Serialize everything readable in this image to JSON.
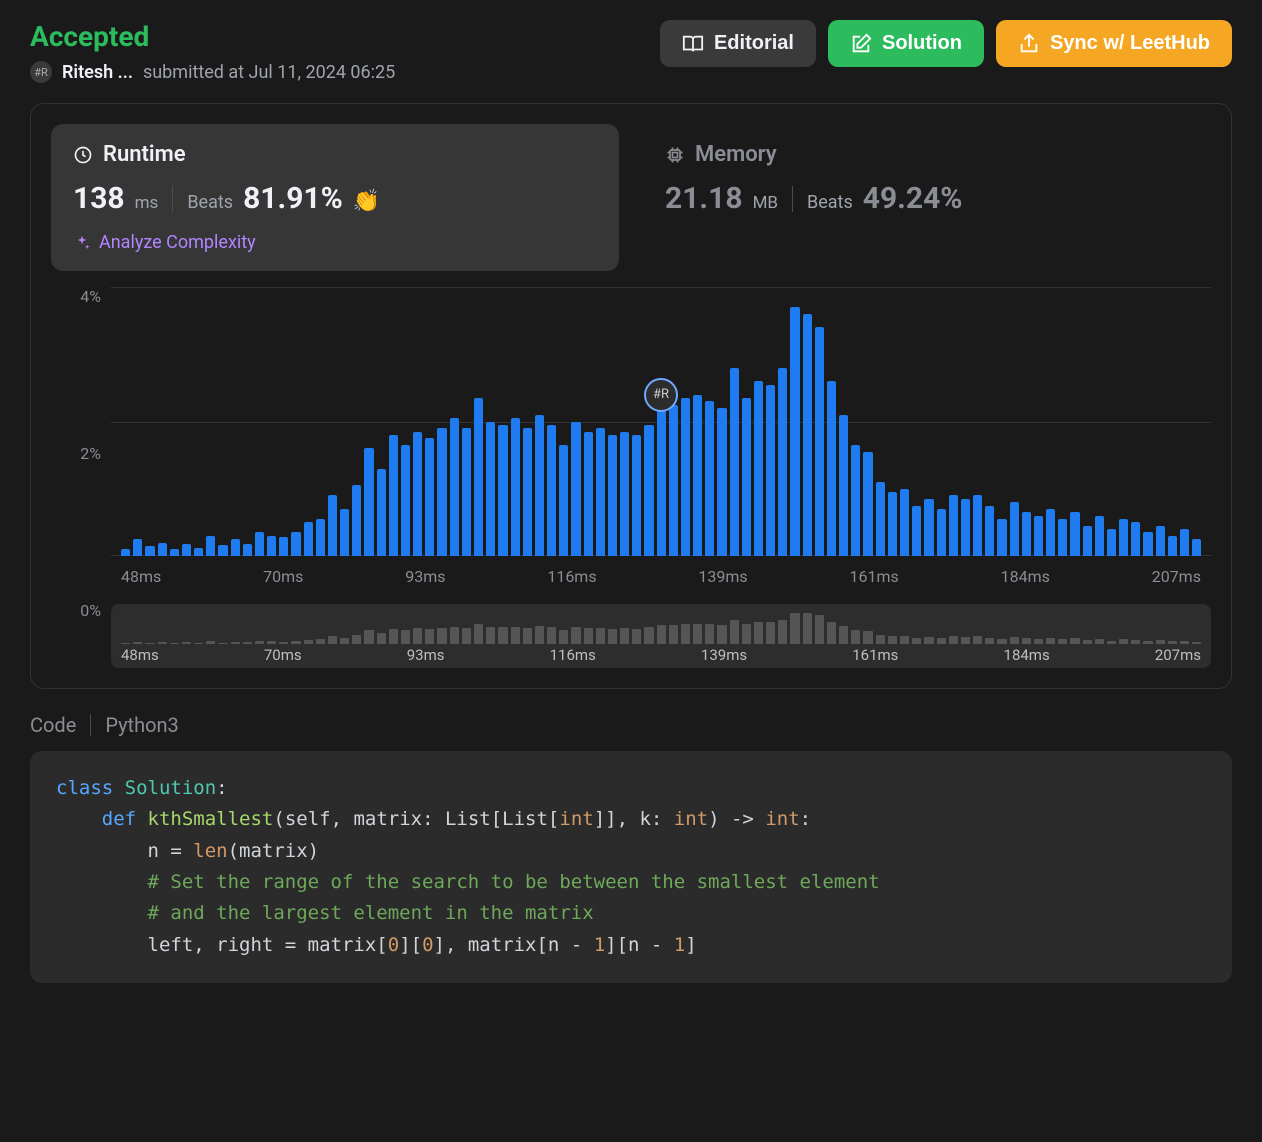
{
  "header": {
    "status": "Accepted",
    "username": "Ritesh ...",
    "submitted_at": "submitted at Jul 11, 2024 06:25",
    "avatar_text": "#R"
  },
  "buttons": {
    "editorial": "Editorial",
    "solution": "Solution",
    "sync": "Sync w/ LeetHub"
  },
  "stats": {
    "runtime": {
      "title": "Runtime",
      "value": "138",
      "unit": "ms",
      "beats_label": "Beats",
      "beats_pct": "81.91%",
      "clap": "👏"
    },
    "memory": {
      "title": "Memory",
      "value": "21.18",
      "unit": "MB",
      "beats_label": "Beats",
      "beats_pct": "49.24%"
    },
    "analyze": "Analyze Complexity"
  },
  "chart_data": {
    "type": "bar",
    "xlabel": "",
    "ylabel": "",
    "y_ticks": [
      "4%",
      "2%",
      "0%"
    ],
    "ylim": [
      0,
      4
    ],
    "x_ticks": [
      "48ms",
      "70ms",
      "93ms",
      "116ms",
      "139ms",
      "161ms",
      "184ms",
      "207ms"
    ],
    "marker_x": "139ms",
    "marker_label": "#R",
    "values": [
      0.1,
      0.25,
      0.15,
      0.2,
      0.1,
      0.18,
      0.12,
      0.3,
      0.16,
      0.25,
      0.18,
      0.35,
      0.3,
      0.28,
      0.35,
      0.5,
      0.55,
      0.9,
      0.7,
      1.05,
      1.6,
      1.3,
      1.8,
      1.65,
      1.85,
      1.75,
      1.9,
      2.05,
      1.9,
      2.35,
      2.0,
      1.95,
      2.05,
      1.9,
      2.1,
      1.95,
      1.65,
      2.0,
      1.85,
      1.9,
      1.8,
      1.85,
      1.8,
      1.95,
      2.2,
      2.25,
      2.35,
      2.4,
      2.3,
      2.2,
      2.8,
      2.35,
      2.6,
      2.55,
      2.8,
      3.7,
      3.6,
      3.4,
      2.6,
      2.1,
      1.65,
      1.55,
      1.1,
      0.95,
      1.0,
      0.75,
      0.85,
      0.7,
      0.9,
      0.85,
      0.9,
      0.75,
      0.55,
      0.8,
      0.65,
      0.6,
      0.7,
      0.55,
      0.65,
      0.45,
      0.6,
      0.4,
      0.55,
      0.5,
      0.35,
      0.45,
      0.3,
      0.4,
      0.25
    ]
  },
  "code": {
    "label": "Code",
    "language": "Python3",
    "lines": {
      "p1": "class",
      "p2": "Solution",
      "p3": ":",
      "p4": "def",
      "p5": "kthSmallest",
      "p6": "(self, matrix: List[List[",
      "p7": "int",
      "p8": "]], k: ",
      "p9": ") -> ",
      "p10": ":",
      "p11": "        n = ",
      "p12": "len",
      "p13": "(matrix)",
      "c1": "        # Set the range of the search to be between the smallest element",
      "c2": "        # and the largest element in the matrix",
      "p14": "        left, right = matrix[",
      "n0": "0",
      "p15": "][",
      "p16": "], matrix[n - ",
      "n1": "1",
      "p17": "][n - ",
      "p18": "]"
    }
  }
}
